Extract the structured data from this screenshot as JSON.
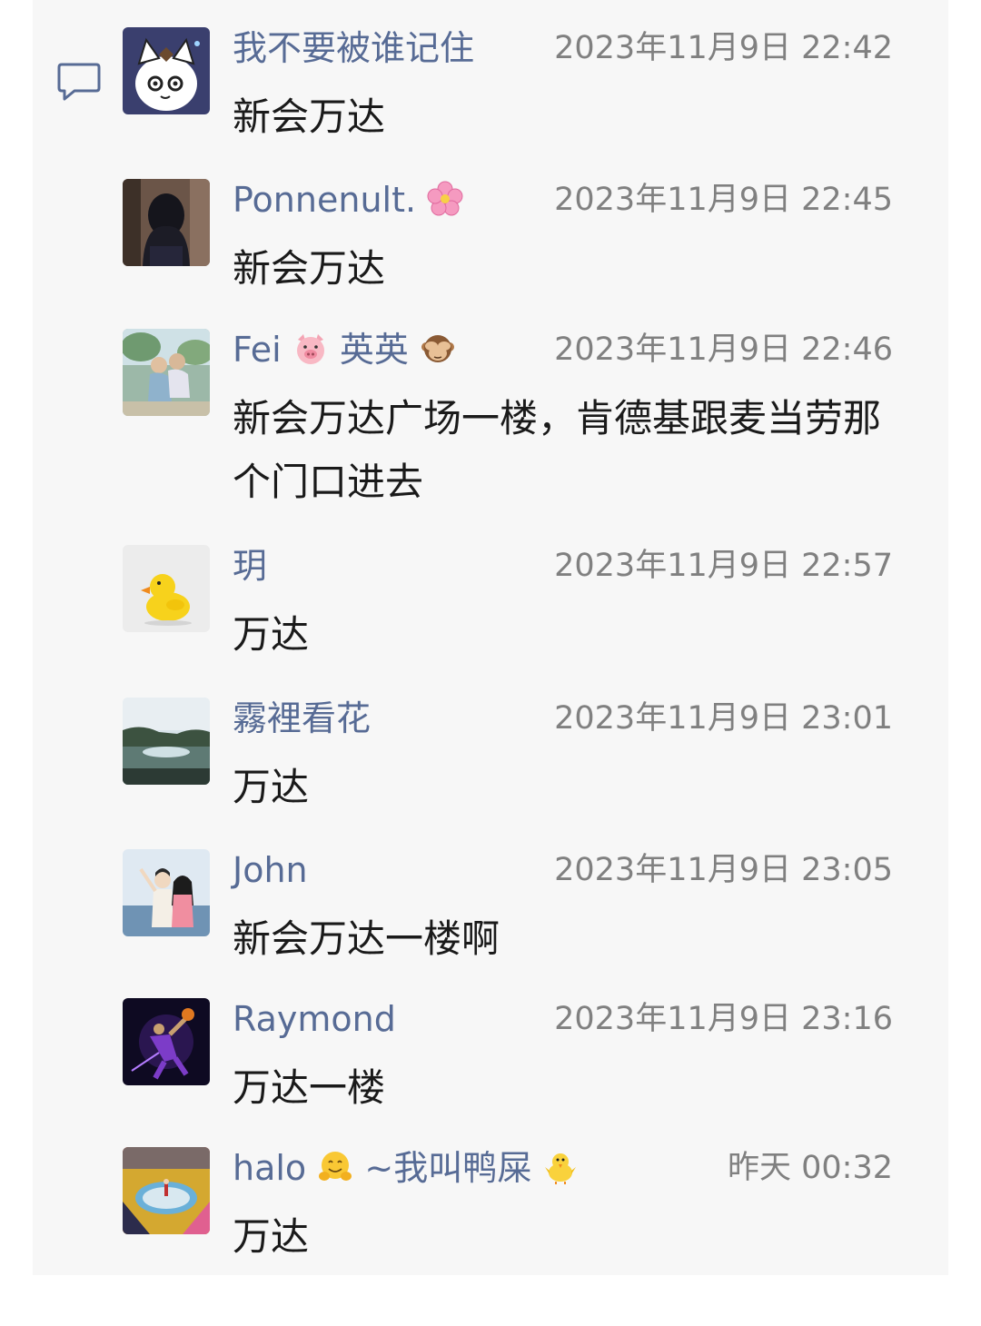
{
  "comments": [
    {
      "name": "我不要被谁记住",
      "time": "2023年11月9日 22:42",
      "text": "新会万达",
      "avatar": "cartoon-cat-avatar"
    },
    {
      "name": "Ponnenult.",
      "name_emoji": "cherry-blossom-emoji",
      "time": "2023年11月9日 22:45",
      "text": "新会万达",
      "avatar": "dark-hair-avatar"
    },
    {
      "name_a": "Fei",
      "name_b": "英英",
      "name_emoji_a": "pig-face-emoji",
      "name_emoji_b": "see-no-evil-monkey-emoji",
      "time": "2023年11月9日 22:46",
      "text": "新会万达广场一楼，肯德基跟麦当劳那个门口进去",
      "avatar": "couple-photo-avatar"
    },
    {
      "name": "玥",
      "time": "2023年11月9日 22:57",
      "text": "万达",
      "avatar": "rubber-duck-avatar"
    },
    {
      "name": "霧裡看花",
      "time": "2023年11月9日 23:01",
      "text": "万达",
      "avatar": "lake-landscape-avatar"
    },
    {
      "name": "John",
      "time": "2023年11月9日 23:05",
      "text": "新会万达一楼啊",
      "avatar": "couple-illustration-avatar"
    },
    {
      "name": "Raymond",
      "time": "2023年11月9日 23:16",
      "text": "万达一楼",
      "avatar": "basketball-player-avatar"
    },
    {
      "name_a": "halo",
      "name_b": "~我叫鸭屎",
      "name_emoji_a": "hugging-face-emoji",
      "name_emoji_b": "baby-chick-emoji",
      "time": "昨天 00:32",
      "text": "万达",
      "avatar": "street-art-avatar"
    }
  ],
  "colors": {
    "name": "#576b95",
    "time": "#808080",
    "text": "#1a1a1a",
    "panel": "#f7f7f7"
  }
}
